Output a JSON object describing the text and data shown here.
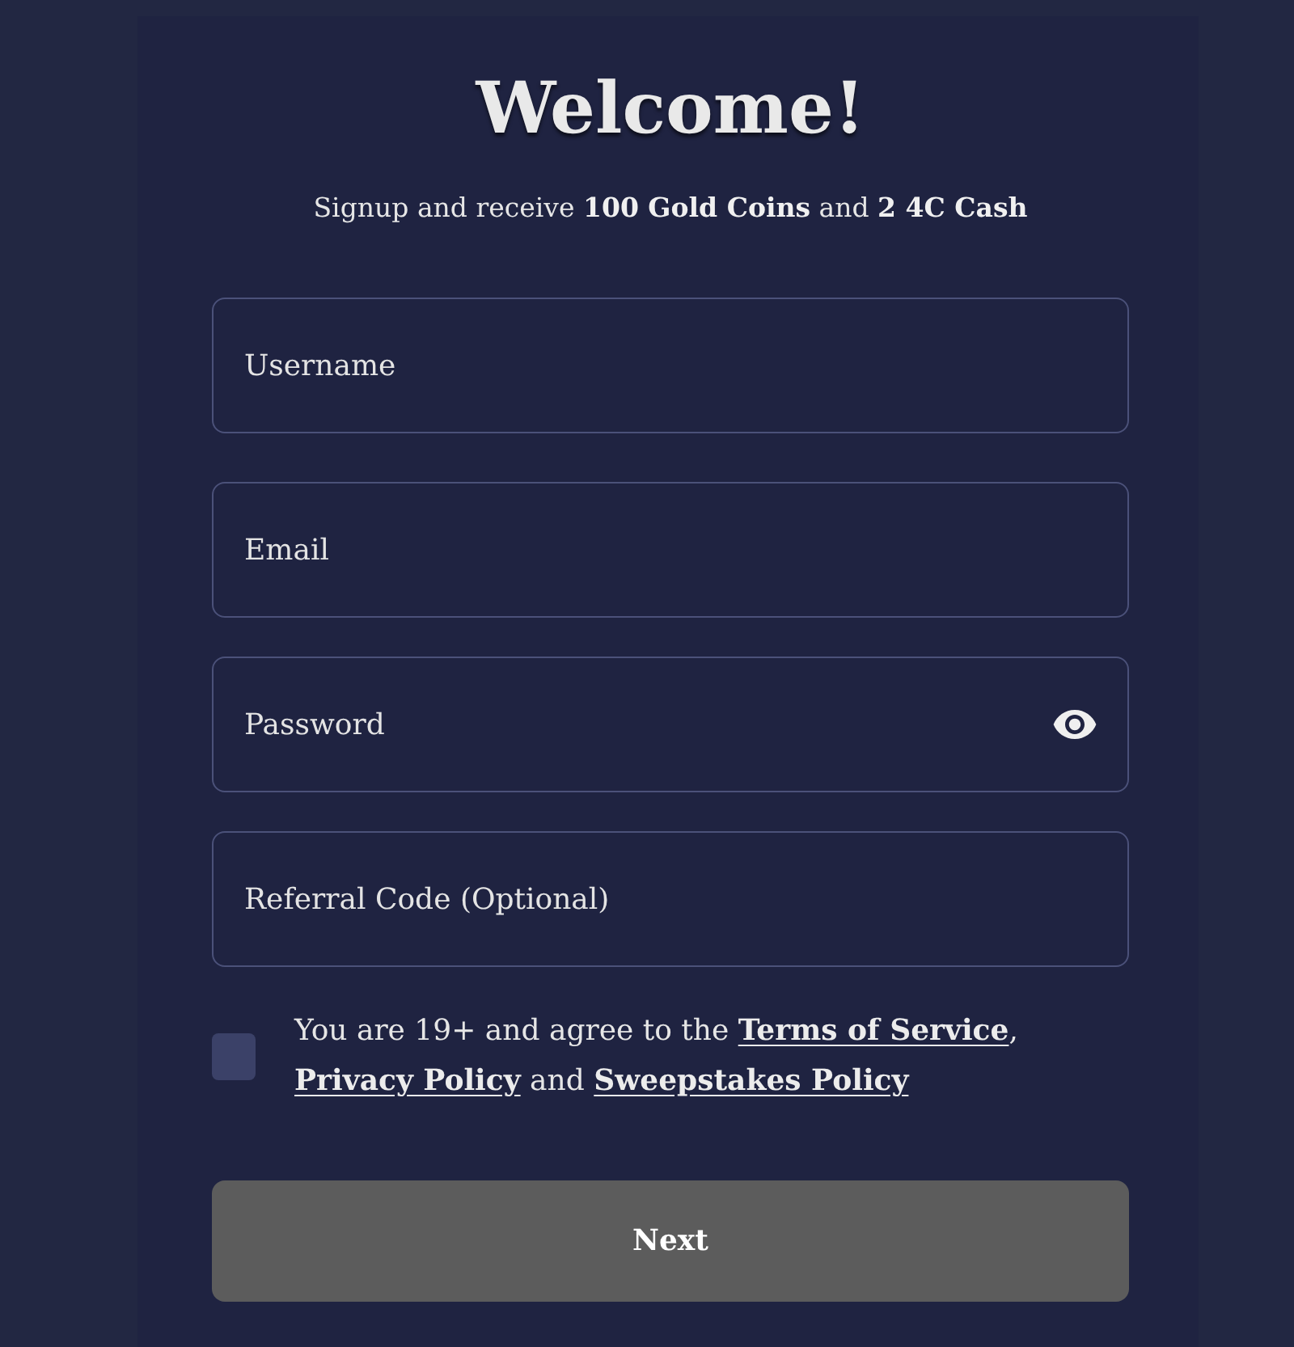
{
  "heading": "Welcome!",
  "subtitle": "Signup and receive **100 Gold Coins** and **2 4C Cash**",
  "fields": [
    {
      "kind": "text",
      "placeholder": "Username"
    },
    {
      "kind": "email",
      "placeholder": "Email"
    },
    {
      "kind": "password",
      "placeholder": "Password"
    },
    {
      "kind": "text",
      "placeholder": "Referral Code (Optional)"
    }
  ],
  "agreement": {
    "checked": false,
    "segments": [
      {
        "kind": "text",
        "text": "You are 19+ and agree to the "
      },
      {
        "kind": "link",
        "text": "Terms of Service"
      },
      {
        "kind": "text",
        "text": ", "
      },
      {
        "kind": "link",
        "text": "Privacy Policy"
      },
      {
        "kind": "text",
        "text": " and "
      },
      {
        "kind": "link",
        "text": "Sweepstakes Policy"
      }
    ]
  },
  "next_button": {
    "label": "Next",
    "disabled": true
  }
}
